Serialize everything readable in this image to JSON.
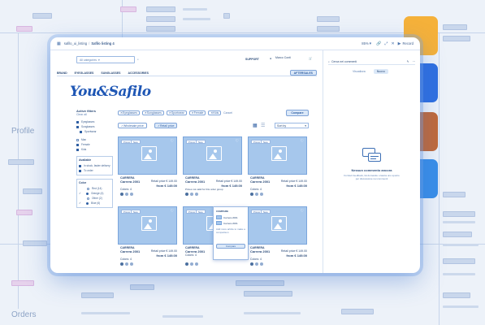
{
  "background": {
    "sections": [
      "Profile",
      "Orders"
    ]
  },
  "window": {
    "breadcrumb_root": "safilo_ui_listing",
    "breadcrumb_sep": "/",
    "breadcrumb_current": "Safilo listing 4",
    "zoom": "85%",
    "record": "Record"
  },
  "app": {
    "search_placeholder": "All categories",
    "support": "SUPPORT",
    "user": "Marco Conti",
    "nav": [
      "BRAND",
      "EYEGLASSES",
      "SUNGLASSES",
      "ACCESSORIES"
    ],
    "aftersales": "AFTERSALES",
    "logo": "You&Safilo",
    "filters_title": "Active filters",
    "clear_all": "Clear all",
    "filter_groups": [
      {
        "items": [
          "Eyeglasses",
          "Sunglasses",
          "Sportwear"
        ],
        "checked": [
          true,
          true,
          true
        ]
      },
      {
        "items": [
          "Man",
          "Female",
          "Kids"
        ],
        "checked": [
          false,
          true,
          true
        ]
      }
    ],
    "availability_title": "Available",
    "availability_items": [
      "In stock, faster delivery",
      "To order"
    ],
    "color_title": "Color",
    "color_items": [
      "Red (14)",
      "Orange (4)",
      "Other (2)",
      "Blue (6)"
    ],
    "chips": [
      "Eyeglasses",
      "Sunglasses",
      "Sportwear",
      "Female",
      "Kids"
    ],
    "chips_clear": "Cancel",
    "compare": "Compare",
    "wholesale_price": "Wholesale price",
    "retail_price": "Retail price",
    "sort": "Sort by",
    "product": {
      "badge1": "Promo",
      "badge2": "New",
      "brand": "CARRERA",
      "name": "Carrera 2001",
      "price_label": "Retail price € 149.00",
      "price": "from € 149.00",
      "colors": "Colors: 4"
    },
    "tooltip_notice": "Prices not valid for this order group",
    "popover": {
      "title": "COMPARE",
      "line1": "Carrera 2001",
      "line2": "Carrera 2001",
      "note": "Add more article to make a comparison",
      "button": "Compare"
    }
  },
  "comments": {
    "search": "Cerca nei commenti",
    "tabs": [
      "Visualizza",
      "Nuovo"
    ],
    "empty_title": "Nessun commento ancora",
    "empty_text": "Fornisci feedback, fai domande o lascia uno spunto per discussione nei commenti"
  },
  "colors": {
    "accent": "#2f5fa3",
    "tile1": "#f5b13a",
    "tile2": "#2f6fe0",
    "tile3": "#c0693a",
    "tile4": "#3a8ee8"
  }
}
